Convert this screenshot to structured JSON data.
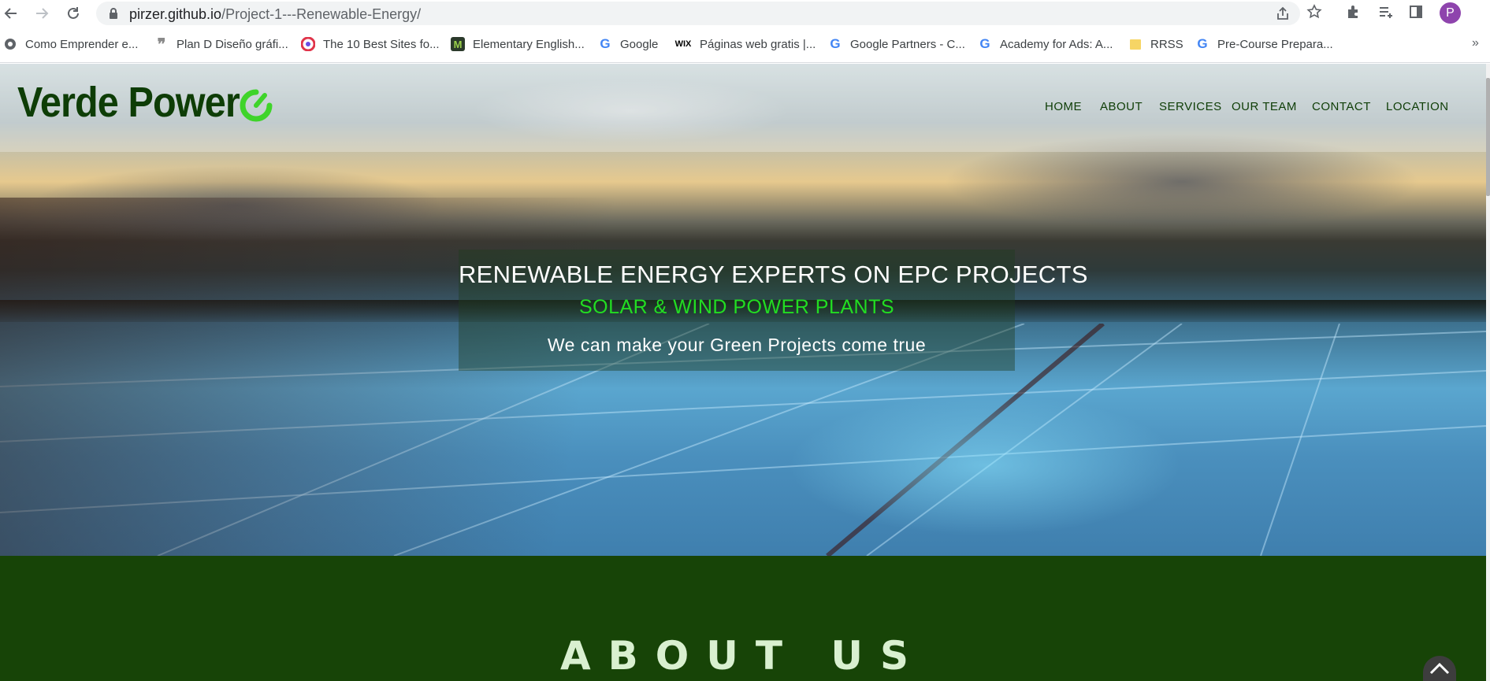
{
  "browser": {
    "url_host": "pirzer.github.io",
    "url_path": "/Project-1---Renewable-Energy/",
    "profile_initial": "P",
    "bookmarks": [
      {
        "label": "Como Emprender e...",
        "icon": "globe-icon"
      },
      {
        "label": "Plan D Diseño gráfi...",
        "icon": "quote-icon"
      },
      {
        "label": "The 10 Best Sites fo...",
        "icon": "swirl-icon"
      },
      {
        "label": "Elementary English...",
        "icon": "m-icon"
      },
      {
        "label": "Google",
        "icon": "google-icon"
      },
      {
        "label": "Páginas web gratis |...",
        "icon": "wix-icon"
      },
      {
        "label": "Google Partners - C...",
        "icon": "google-icon"
      },
      {
        "label": "Academy for Ads: A...",
        "icon": "google-icon"
      },
      {
        "label": "RRSS",
        "icon": "folder-icon"
      },
      {
        "label": "Pre-Course Prepara...",
        "icon": "google-icon"
      }
    ],
    "more_bookmarks": "»"
  },
  "site": {
    "logo_text": "Verde Power",
    "logo_color": "#0e3d06",
    "accent_color": "#22dd22",
    "nav": [
      "HOME",
      "ABOUT",
      "SERVICES",
      "OUR TEAM",
      "CONTACT",
      "LOCATION"
    ],
    "hero": {
      "title": "RENEWABLE ENERGY EXPERTS ON EPC PROJECTS",
      "subtitle": "SOLAR & WIND POWER PLANTS",
      "tagline": "We can make your Green Projects come true"
    },
    "about": {
      "title": "ABOUT US",
      "background": "#174407"
    }
  }
}
